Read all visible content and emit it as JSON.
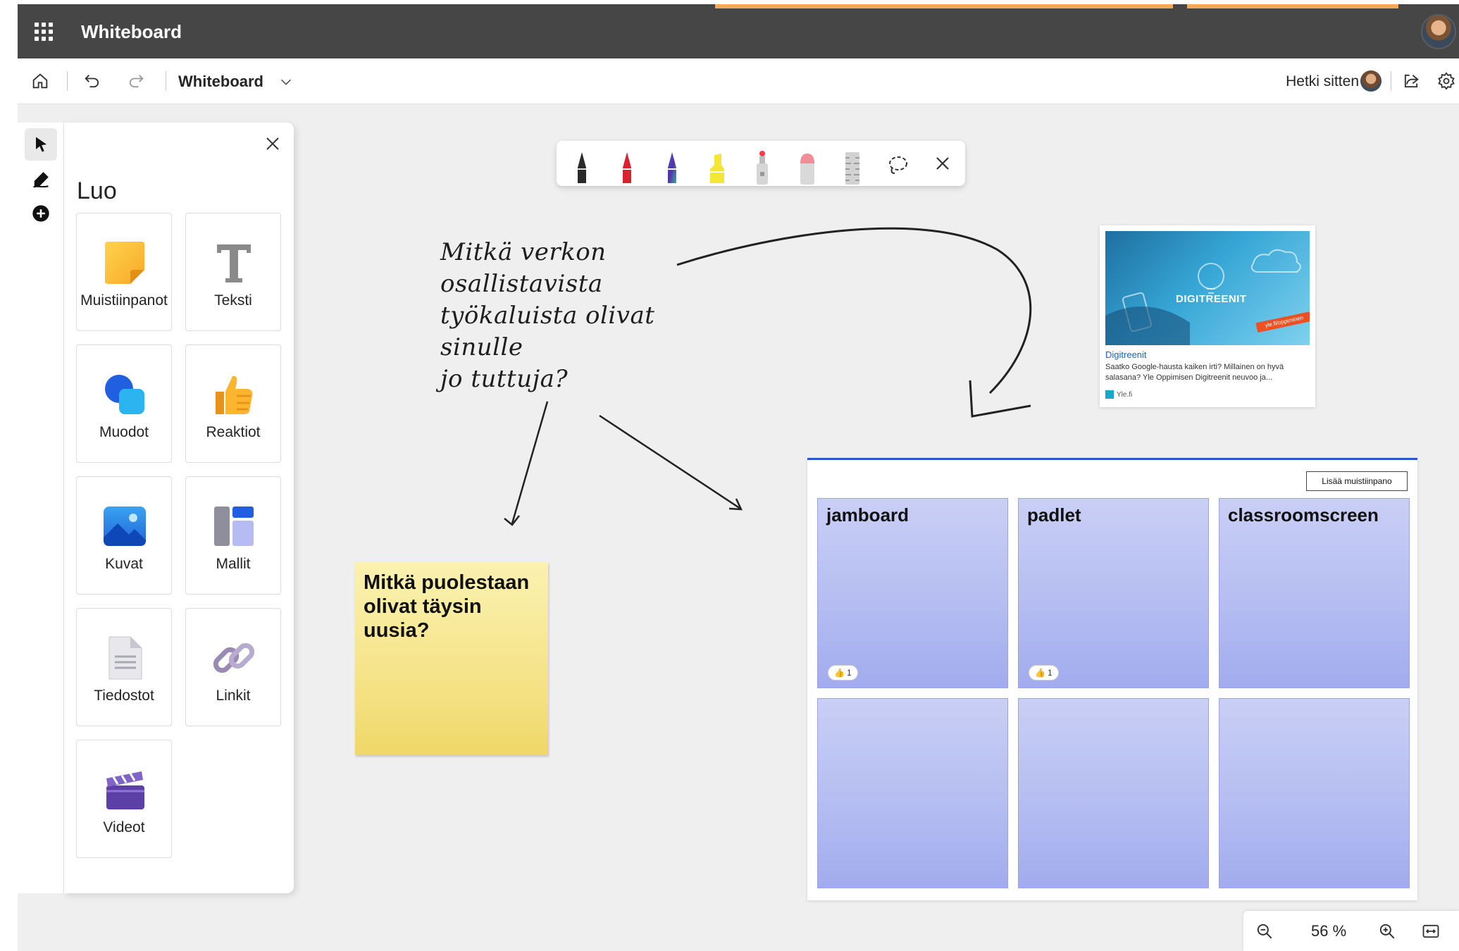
{
  "app": {
    "title": "Whiteboard"
  },
  "command_bar": {
    "board_name": "Whiteboard",
    "last_edited": "Hetki sitten"
  },
  "create_panel": {
    "title": "Luo",
    "items": [
      {
        "label": "Muistiinpanot",
        "icon": "sticky-note-icon"
      },
      {
        "label": "Teksti",
        "icon": "text-icon"
      },
      {
        "label": "Muodot",
        "icon": "shapes-icon"
      },
      {
        "label": "Reaktiot",
        "icon": "thumbs-up-icon"
      },
      {
        "label": "Kuvat",
        "icon": "image-icon"
      },
      {
        "label": "Mallit",
        "icon": "templates-icon"
      },
      {
        "label": "Tiedostot",
        "icon": "file-icon"
      },
      {
        "label": "Linkit",
        "icon": "link-icon"
      },
      {
        "label": "Videot",
        "icon": "video-icon"
      }
    ]
  },
  "ink_toolbar": {
    "tools": [
      "black-pen",
      "red-pen",
      "galaxy-pen",
      "yellow-highlighter",
      "laser-pointer",
      "eraser",
      "ruler",
      "lasso-select",
      "close"
    ]
  },
  "canvas": {
    "handwritten_question": "Mitkä verkon\nosallistavista\ntyökaluista olivat sinulle\njo tuttuja?",
    "sticky_note": "Mitkä puolestaan olivat täysin uusia?",
    "link_card": {
      "title": "Digitreenit",
      "description": "Saatko Google-hausta kaiken irti? Millainen on hyvä salasana? Yle Oppimisen Digitreenit neuvoo ja...",
      "source": "Yle.fi",
      "image_brand": "DIGITREENIT",
      "image_ribbon": "yle.fi/oppiminen"
    },
    "grid": {
      "add_button": "Lisää muistiinpano",
      "cells": [
        {
          "title": "jamboard",
          "reaction": "1"
        },
        {
          "title": "padlet",
          "reaction": "1"
        },
        {
          "title": "classroomscreen"
        },
        {
          "title": ""
        },
        {
          "title": ""
        },
        {
          "title": ""
        }
      ]
    }
  },
  "zoom": {
    "value": "56 %"
  }
}
